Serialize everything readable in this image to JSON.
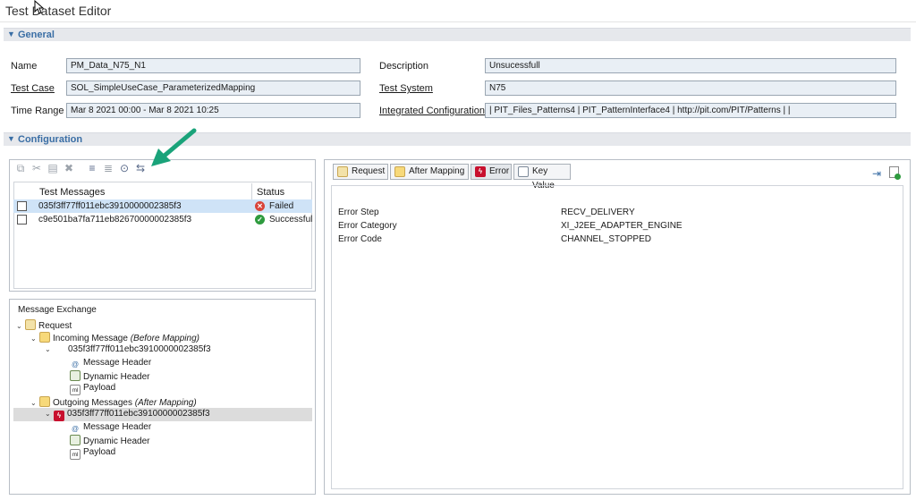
{
  "window": {
    "title": "Test Dataset Editor"
  },
  "sections": {
    "general": "General",
    "configuration": "Configuration"
  },
  "general": {
    "name_label": "Name",
    "name_value": "PM_Data_N75_N1",
    "description_label": "Description",
    "description_value": "Unsucessfull",
    "test_case_label": "Test Case",
    "test_case_value": "SOL_SimpleUseCase_ParameterizedMapping",
    "test_system_label": "Test System",
    "test_system_value": "N75",
    "time_range_label": "Time Range",
    "time_range_value": "Mar 8 2021 00:00 - Mar 8 2021 10:25",
    "integrated_config_label": "Integrated Configuration",
    "integrated_config_value": "| PIT_Files_Patterns4 | PIT_PatternInterface4 | http://pit.com/PIT/Patterns | |"
  },
  "toolbar": {
    "icons": [
      "copy-icon",
      "cut-icon",
      "paste-icon",
      "delete-icon",
      "align-left-icon",
      "align-justify-icon",
      "find-icon",
      "compare-icon"
    ]
  },
  "test_messages": {
    "col_messages": "Test Messages",
    "col_status": "Status",
    "rows": [
      {
        "id": "035f3ff77ff011ebc3910000002385f3",
        "status": "Failed",
        "status_color": "#d9443a"
      },
      {
        "id": "c9e501ba7fa711eb82670000002385f3",
        "status": "Successful",
        "status_color": "#2e9b3e"
      }
    ]
  },
  "message_exchange": {
    "title": "Message Exchange",
    "request": "Request",
    "incoming": "Incoming Message",
    "incoming_note": "(Before Mapping)",
    "incoming_id": "035f3ff77ff011ebc3910000002385f3",
    "message_header": "Message Header",
    "dynamic_header": "Dynamic Header",
    "payload": "Payload",
    "outgoing": "Outgoing Messages",
    "outgoing_note": "(After Mapping)",
    "outgoing_id": "035f3ff77ff011ebc3910000002385f3"
  },
  "detail_tabs": {
    "request": "Request",
    "after_mapping": "After Mapping",
    "error": "Error",
    "key_value": "Key Value"
  },
  "error_details": {
    "error_step_label": "Error Step",
    "error_step_value": "RECV_DELIVERY",
    "error_category_label": "Error Category",
    "error_category_value": "XI_J2EE_ADAPTER_ENGINE",
    "error_code_label": "Error Code",
    "error_code_value": "CHANNEL_STOPPED"
  },
  "colors": {
    "accent": "#3a6ea5",
    "arrow": "#1aa37a",
    "selection": "#cfe3f7",
    "error_icon": "#c8102e"
  }
}
